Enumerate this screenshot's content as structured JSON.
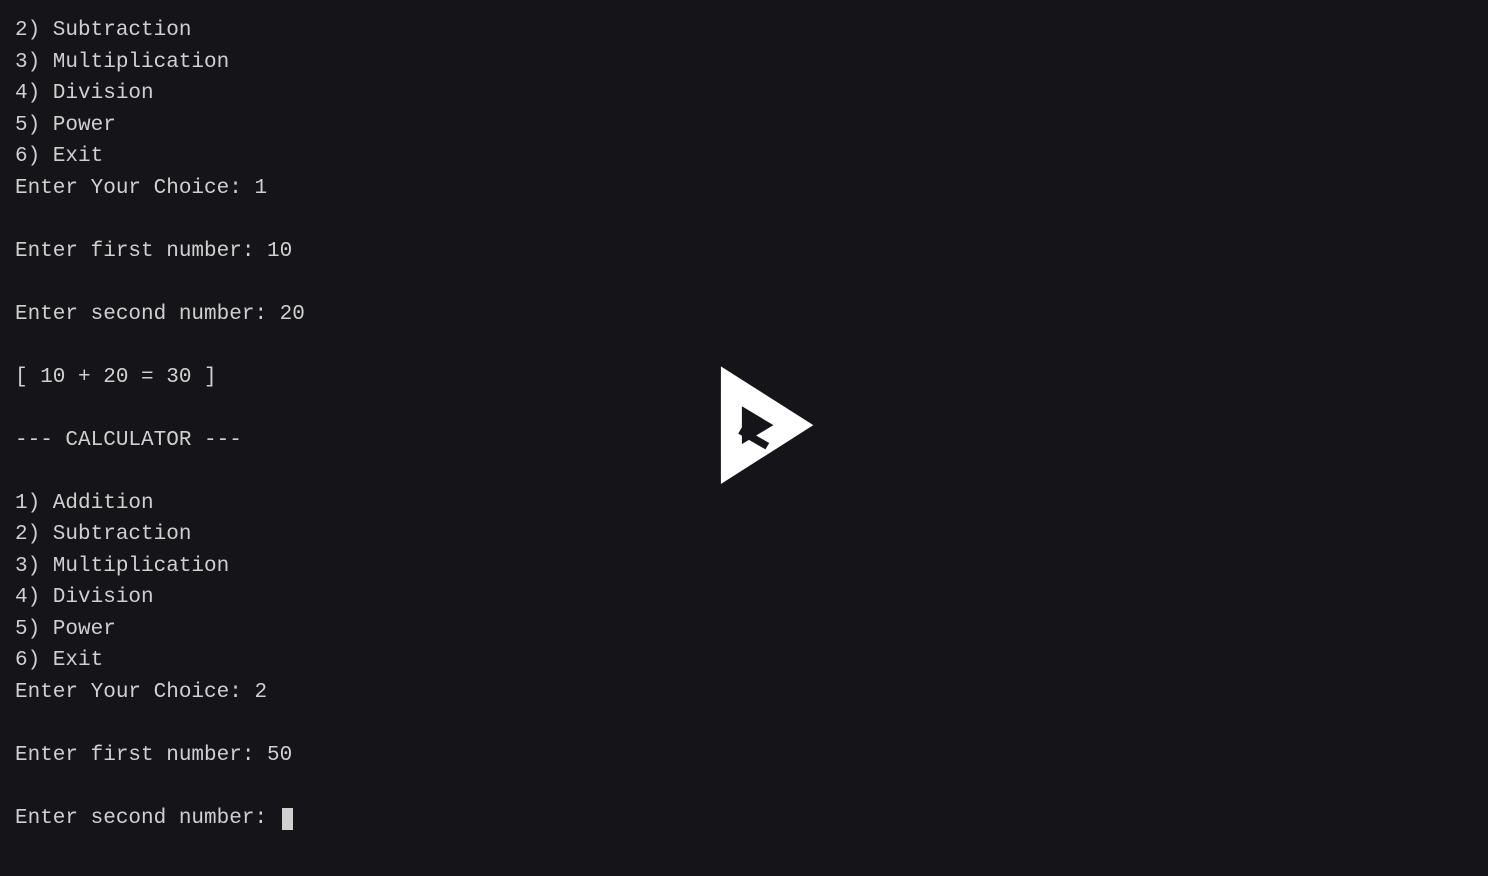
{
  "terminal": {
    "lines": [
      "2) Subtraction",
      "3) Multiplication",
      "4) Division",
      "5) Power",
      "6) Exit",
      "Enter Your Choice: 1",
      "",
      "Enter first number: 10",
      "",
      "Enter second number: 20",
      "",
      "[ 10 + 20 = 30 ]",
      "",
      "--- CALCULATOR ---",
      "",
      "1) Addition",
      "2) Subtraction",
      "3) Multiplication",
      "4) Division",
      "5) Power",
      "6) Exit",
      "Enter Your Choice: 2",
      "",
      "Enter first number: 50",
      ""
    ],
    "cursor_line": "Enter second number: "
  },
  "overlay": {
    "play_button": "play-icon"
  }
}
